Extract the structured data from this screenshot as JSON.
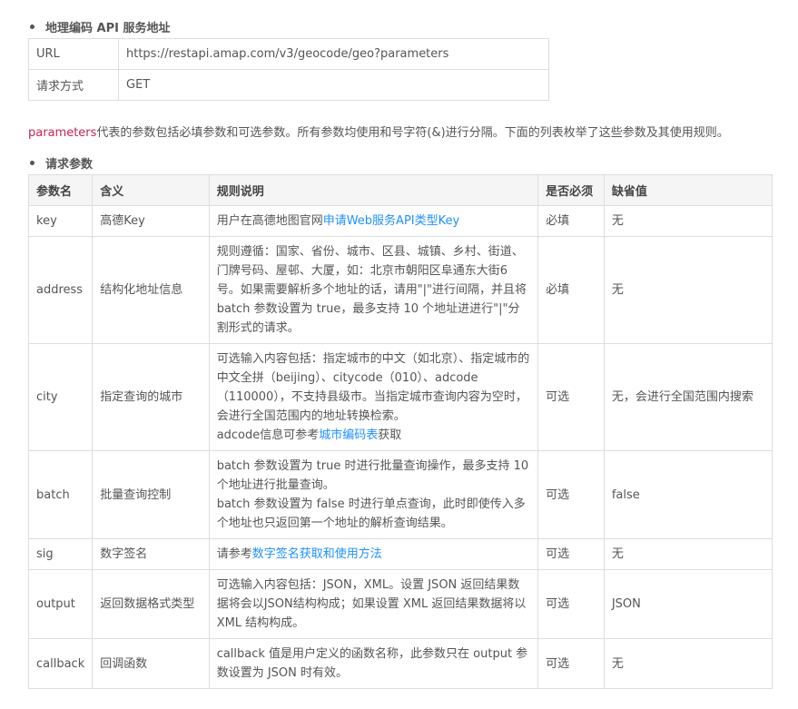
{
  "service": {
    "heading": "地理编码 API 服务地址",
    "rows": [
      {
        "key": "URL",
        "value": "https://restapi.amap.com/v3/geocode/geo?parameters"
      },
      {
        "key": "请求方式",
        "value": "GET"
      }
    ]
  },
  "intro": {
    "code": "parameters",
    "text": "代表的参数包括必填参数和可选参数。所有参数均使用和号字符(&)进行分隔。下面的列表枚举了这些参数及其使用规则。"
  },
  "params": {
    "heading": "请求参数",
    "columns": [
      "参数名",
      "含义",
      "规则说明",
      "是否必须",
      "缺省值"
    ],
    "rows": [
      {
        "name": "key",
        "meaning": "高德Key",
        "rule_pre": "用户在高德地图官网",
        "rule_link": "申请Web服务API类型Key",
        "rule_post": "",
        "required": "必填",
        "default": "无"
      },
      {
        "name": "address",
        "meaning": "结构化地址信息",
        "rule_pre": "规则遵循：国家、省份、城市、区县、城镇、乡村、街道、门牌号码、屋邨、大厦，如：北京市朝阳区阜通东大街6号。如果需要解析多个地址的话，请用\"|\"进行间隔，并且将 batch 参数设置为 true，最多支持 10 个地址进进行\"|\"分割形式的请求。",
        "rule_link": "",
        "rule_post": "",
        "required": "必填",
        "default": "无"
      },
      {
        "name": "city",
        "meaning": "指定查询的城市",
        "rule_pre": "可选输入内容包括：指定城市的中文（如北京）、指定城市的中文全拼（beijing）、citycode（010）、adcode（110000），不支持县级市。当指定城市查询内容为空时，会进行全国范围内的地址转换检索。",
        "rule_line2_pre": "adcode信息可参考",
        "rule_link": "城市编码表",
        "rule_post": "获取",
        "required": "可选",
        "default": "无，会进行全国范围内搜索"
      },
      {
        "name": "batch",
        "meaning": "批量查询控制",
        "rule_pre": "batch 参数设置为 true 时进行批量查询操作，最多支持 10 个地址进行批量查询。",
        "rule_line2_pre": "batch 参数设置为 false 时进行单点查询，此时即使传入多个地址也只返回第一个地址的解析查询结果。",
        "rule_link": "",
        "rule_post": "",
        "required": "可选",
        "default": "false"
      },
      {
        "name": "sig",
        "meaning": "数字签名",
        "rule_pre": "请参考",
        "rule_link": "数字签名获取和使用方法",
        "rule_post": "",
        "required": "可选",
        "default": "无"
      },
      {
        "name": "output",
        "meaning": "返回数据格式类型",
        "rule_pre": "可选输入内容包括：JSON，XML。设置 JSON 返回结果数据将会以JSON结构构成；如果设置 XML 返回结果数据将以 XML 结构构成。",
        "rule_link": "",
        "rule_post": "",
        "required": "可选",
        "default": "JSON"
      },
      {
        "name": "callback",
        "meaning": "回调函数",
        "rule_pre": "callback 值是用户定义的函数名称，此参数只在 output 参数设置为 JSON 时有效。",
        "rule_link": "",
        "rule_post": "",
        "required": "可选",
        "default": "无"
      }
    ]
  }
}
